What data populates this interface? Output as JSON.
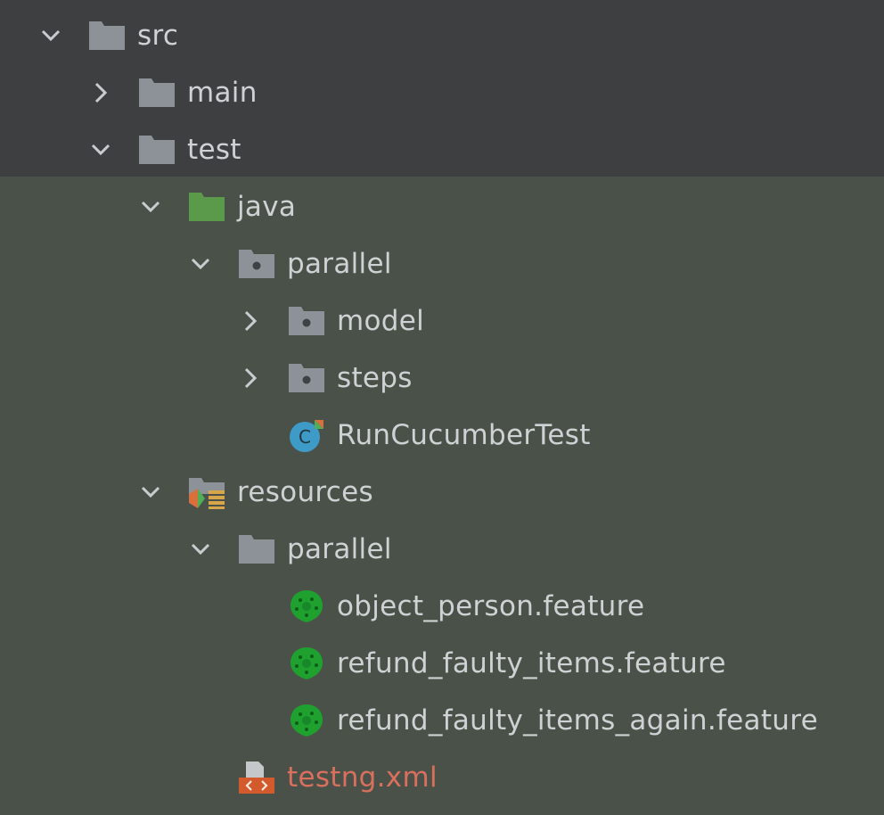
{
  "tree": {
    "items": [
      {
        "label": "src",
        "expanded": true,
        "icon": "folder-icon"
      },
      {
        "label": "main",
        "expanded": false,
        "icon": "folder-icon"
      },
      {
        "label": "test",
        "expanded": true,
        "icon": "folder-icon"
      },
      {
        "label": "java",
        "expanded": true,
        "icon": "test-sources-folder-icon"
      },
      {
        "label": "parallel",
        "expanded": true,
        "icon": "package-icon"
      },
      {
        "label": "model",
        "expanded": false,
        "icon": "package-icon"
      },
      {
        "label": "steps",
        "expanded": false,
        "icon": "package-icon"
      },
      {
        "label": "RunCucumberTest",
        "icon": "java-class-icon"
      },
      {
        "label": "resources",
        "expanded": true,
        "icon": "test-resources-folder-icon"
      },
      {
        "label": "parallel",
        "expanded": true,
        "icon": "folder-icon"
      },
      {
        "label": "object_person.feature",
        "icon": "cucumber-icon"
      },
      {
        "label": "refund_faulty_items.feature",
        "icon": "cucumber-icon"
      },
      {
        "label": "refund_faulty_items_again.feature",
        "icon": "cucumber-icon"
      },
      {
        "label": "testng.xml",
        "icon": "xml-file-icon",
        "status": "untracked"
      }
    ]
  },
  "colors": {
    "header_bg": "#3d3f41",
    "body_bg": "#4a5149",
    "text": "#cfd2d4",
    "untracked_text": "#d9705e",
    "folder": "#8d9298",
    "test_folder": "#5b9a4a",
    "cucumber": "#1fa02f",
    "class_icon": "#3e9bc8"
  }
}
